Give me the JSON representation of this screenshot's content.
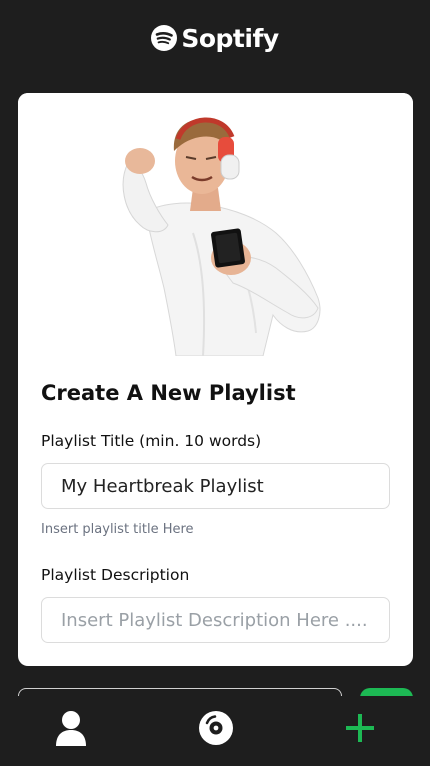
{
  "app": {
    "brand_name": "Soptify",
    "accent_color": "#1db954"
  },
  "card": {
    "hero_image": "man-with-headphones-holding-phone",
    "title": "Create A New Playlist",
    "playlist_title": {
      "label": "Playlist Title (min. 10 words)",
      "value": "My Heartbreak Playlist",
      "helper": "Insert playlist title Here"
    },
    "playlist_description": {
      "label": "Playlist Description",
      "placeholder": "Insert Playlist Description Here ...."
    }
  },
  "nav": {
    "items": [
      {
        "icon": "user-icon"
      },
      {
        "icon": "disc-icon"
      },
      {
        "icon": "plus-icon"
      }
    ]
  }
}
